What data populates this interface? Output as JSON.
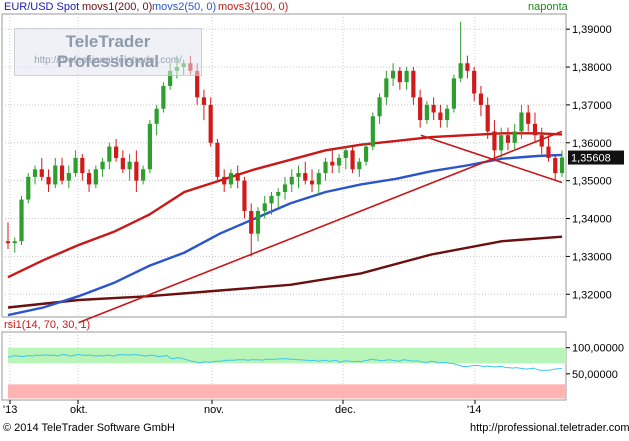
{
  "header": {
    "symbol": "EUR/USD Spot",
    "ma1": "movs1(200, 0)",
    "ma2": "movs2(50, 0)",
    "ma3": "movs3(100, 0)",
    "period": "naponta"
  },
  "watermark": {
    "title": "TeleTrader Professional",
    "url": "http://professional.teletrader.com/"
  },
  "footer": {
    "copyright": "© 2014 TeleTrader Software GmbH",
    "url": "http://professional.teletrader.com"
  },
  "colors": {
    "up": "#2e9e2e",
    "down": "#d11a1a",
    "ma200": "#6b0f0f",
    "ma50": "#2a55cc",
    "ma100": "#c81818",
    "rsi": "#3cc6f0",
    "rsi_upper_band": "#b9f5b9",
    "rsi_lower_band": "#ffb3b3"
  },
  "chart_data": [
    {
      "type": "candlestick",
      "title": "EUR/USD Spot",
      "ylim": [
        1.314,
        1.394
      ],
      "y_ticks": [
        "1,39000",
        "1,38000",
        "1,37000",
        "1,36000",
        "1,35000",
        "1,34000",
        "1,33000",
        "1,32000"
      ],
      "x_ticks": [
        "'13",
        "okt.",
        "nov.",
        "dec.",
        "'14"
      ],
      "last_price_label": "1,35608",
      "grid": true,
      "candles": [
        [
          1.334,
          1.339,
          1.332,
          1.3335
        ],
        [
          1.3335,
          1.335,
          1.331,
          1.334
        ],
        [
          1.334,
          1.346,
          1.333,
          1.345
        ],
        [
          1.345,
          1.352,
          1.344,
          1.351
        ],
        [
          1.351,
          1.354,
          1.349,
          1.353
        ],
        [
          1.353,
          1.356,
          1.35,
          1.351
        ],
        [
          1.351,
          1.353,
          1.347,
          1.349
        ],
        [
          1.349,
          1.356,
          1.348,
          1.354
        ],
        [
          1.354,
          1.356,
          1.349,
          1.35
        ],
        [
          1.35,
          1.354,
          1.348,
          1.352
        ],
        [
          1.352,
          1.358,
          1.351,
          1.356
        ],
        [
          1.356,
          1.357,
          1.35,
          1.352
        ],
        [
          1.352,
          1.353,
          1.347,
          1.349
        ],
        [
          1.349,
          1.354,
          1.348,
          1.353
        ],
        [
          1.353,
          1.356,
          1.351,
          1.355
        ],
        [
          1.355,
          1.36,
          1.353,
          1.359
        ],
        [
          1.359,
          1.361,
          1.355,
          1.356
        ],
        [
          1.356,
          1.358,
          1.352,
          1.353
        ],
        [
          1.353,
          1.357,
          1.35,
          1.355
        ],
        [
          1.355,
          1.358,
          1.347,
          1.35
        ],
        [
          1.35,
          1.354,
          1.349,
          1.353
        ],
        [
          1.353,
          1.366,
          1.352,
          1.365
        ],
        [
          1.365,
          1.37,
          1.362,
          1.369
        ],
        [
          1.369,
          1.376,
          1.368,
          1.375
        ],
        [
          1.375,
          1.381,
          1.374,
          1.379
        ],
        [
          1.379,
          1.383,
          1.377,
          1.38
        ],
        [
          1.38,
          1.382,
          1.378,
          1.381
        ],
        [
          1.381,
          1.383,
          1.378,
          1.379
        ],
        [
          1.379,
          1.381,
          1.37,
          1.372
        ],
        [
          1.372,
          1.374,
          1.366,
          1.37
        ],
        [
          1.37,
          1.372,
          1.359,
          1.36
        ],
        [
          1.36,
          1.361,
          1.35,
          1.351
        ],
        [
          1.351,
          1.353,
          1.347,
          1.349
        ],
        [
          1.349,
          1.353,
          1.348,
          1.352
        ],
        [
          1.352,
          1.354,
          1.348,
          1.35
        ],
        [
          1.35,
          1.351,
          1.34,
          1.342
        ],
        [
          1.342,
          1.344,
          1.33,
          1.336
        ],
        [
          1.336,
          1.343,
          1.334,
          1.342
        ],
        [
          1.342,
          1.346,
          1.34,
          1.344
        ],
        [
          1.344,
          1.347,
          1.341,
          1.346
        ],
        [
          1.346,
          1.348,
          1.343,
          1.347
        ],
        [
          1.347,
          1.351,
          1.345,
          1.349
        ],
        [
          1.349,
          1.353,
          1.347,
          1.351
        ],
        [
          1.351,
          1.354,
          1.348,
          1.352
        ],
        [
          1.352,
          1.355,
          1.349,
          1.35
        ],
        [
          1.35,
          1.353,
          1.347,
          1.349
        ],
        [
          1.349,
          1.353,
          1.346,
          1.352
        ],
        [
          1.352,
          1.356,
          1.35,
          1.355
        ],
        [
          1.355,
          1.358,
          1.352,
          1.354
        ],
        [
          1.354,
          1.357,
          1.352,
          1.356
        ],
        [
          1.356,
          1.359,
          1.353,
          1.358
        ],
        [
          1.358,
          1.359,
          1.352,
          1.353
        ],
        [
          1.353,
          1.356,
          1.351,
          1.355
        ],
        [
          1.355,
          1.36,
          1.354,
          1.359
        ],
        [
          1.359,
          1.368,
          1.358,
          1.367
        ],
        [
          1.367,
          1.373,
          1.365,
          1.372
        ],
        [
          1.372,
          1.379,
          1.37,
          1.377
        ],
        [
          1.377,
          1.381,
          1.375,
          1.379
        ],
        [
          1.379,
          1.38,
          1.374,
          1.376
        ],
        [
          1.376,
          1.38,
          1.374,
          1.379
        ],
        [
          1.379,
          1.38,
          1.37,
          1.372
        ],
        [
          1.372,
          1.374,
          1.364,
          1.366
        ],
        [
          1.366,
          1.371,
          1.365,
          1.37
        ],
        [
          1.37,
          1.372,
          1.366,
          1.368
        ],
        [
          1.368,
          1.37,
          1.364,
          1.366
        ],
        [
          1.366,
          1.37,
          1.364,
          1.369
        ],
        [
          1.369,
          1.378,
          1.368,
          1.377
        ],
        [
          1.377,
          1.392,
          1.376,
          1.381
        ],
        [
          1.381,
          1.383,
          1.377,
          1.379
        ],
        [
          1.379,
          1.38,
          1.371,
          1.373
        ],
        [
          1.373,
          1.375,
          1.367,
          1.37
        ],
        [
          1.37,
          1.372,
          1.361,
          1.363
        ],
        [
          1.363,
          1.366,
          1.356,
          1.358
        ],
        [
          1.358,
          1.364,
          1.356,
          1.362
        ],
        [
          1.362,
          1.364,
          1.358,
          1.36
        ],
        [
          1.36,
          1.365,
          1.358,
          1.363
        ],
        [
          1.363,
          1.37,
          1.361,
          1.368
        ],
        [
          1.368,
          1.37,
          1.363,
          1.365
        ],
        [
          1.365,
          1.368,
          1.36,
          1.362
        ],
        [
          1.362,
          1.364,
          1.357,
          1.359
        ],
        [
          1.359,
          1.362,
          1.355,
          1.356
        ],
        [
          1.356,
          1.357,
          1.35,
          1.352
        ],
        [
          1.352,
          1.358,
          1.351,
          1.3561
        ]
      ],
      "series": [
        {
          "name": "movs1(200, 0)",
          "color": "#6b0f0f",
          "points": [
            [
              0,
              1.3165
            ],
            [
              20,
              1.3185
            ],
            [
              40,
              1.3195
            ],
            [
              60,
              1.321
            ],
            [
              80,
              1.3225
            ],
            [
              100,
              1.3255
            ],
            [
              120,
              1.3305
            ],
            [
              140,
              1.334
            ],
            [
              157,
              1.3352
            ]
          ]
        },
        {
          "name": "movs2(50, 0)",
          "color": "#2a55cc",
          "points": [
            [
              0,
              1.3145
            ],
            [
              10,
              1.3165
            ],
            [
              20,
              1.3195
            ],
            [
              30,
              1.323
            ],
            [
              40,
              1.3275
            ],
            [
              50,
              1.331
            ],
            [
              60,
              1.336
            ],
            [
              70,
              1.34
            ],
            [
              80,
              1.344
            ],
            [
              90,
              1.347
            ],
            [
              100,
              1.349
            ],
            [
              110,
              1.3505
            ],
            [
              120,
              1.3525
            ],
            [
              130,
              1.354
            ],
            [
              140,
              1.3558
            ],
            [
              150,
              1.3565
            ],
            [
              157,
              1.3568
            ]
          ]
        },
        {
          "name": "movs3(100, 0)",
          "color": "#c81818",
          "points": [
            [
              0,
              1.3245
            ],
            [
              10,
              1.329
            ],
            [
              20,
              1.333
            ],
            [
              30,
              1.3365
            ],
            [
              40,
              1.341
            ],
            [
              50,
              1.347
            ],
            [
              60,
              1.35
            ],
            [
              70,
              1.353
            ],
            [
              80,
              1.3555
            ],
            [
              90,
              1.358
            ],
            [
              100,
              1.3595
            ],
            [
              110,
              1.3605
            ],
            [
              120,
              1.3615
            ],
            [
              130,
              1.362
            ],
            [
              140,
              1.3625
            ],
            [
              150,
              1.3625
            ],
            [
              157,
              1.3622
            ]
          ]
        }
      ],
      "trendlines": [
        {
          "from": [
            20,
            1.3125
          ],
          "to": [
            157,
            1.363
          ]
        },
        {
          "from": [
            117,
            1.362
          ],
          "to": [
            157,
            1.3495
          ]
        }
      ]
    },
    {
      "type": "line",
      "title": "rsi1(14, 70, 30, 1)",
      "ylim": [
        0,
        130
      ],
      "y_ticks": [
        "100,00000",
        "50,00000"
      ],
      "overbought": 70,
      "oversold": 30,
      "series": [
        {
          "name": "rsi1(14, 70, 30, 1)",
          "color": "#3cc6f0",
          "values": [
            82,
            83,
            85,
            84,
            83,
            84,
            85,
            84,
            86,
            85,
            86,
            86,
            85,
            86,
            84,
            86,
            87,
            85,
            84,
            86,
            87,
            86,
            85,
            86,
            85,
            84,
            85,
            84,
            86,
            85,
            84,
            86,
            87,
            86,
            86,
            86,
            87,
            86,
            85,
            84,
            85,
            86,
            84,
            83,
            84,
            85,
            80,
            79,
            81,
            80,
            78,
            76,
            74,
            73,
            71,
            72,
            73,
            72,
            73,
            74,
            74,
            75,
            76,
            76,
            76,
            77,
            77,
            77,
            76,
            77,
            77,
            77,
            76,
            78,
            78,
            78,
            78,
            79,
            79,
            79,
            78,
            78,
            77,
            77,
            76,
            76,
            75,
            76,
            74,
            75,
            76,
            74,
            75,
            76,
            72,
            74,
            75,
            74,
            73,
            74,
            73,
            75,
            76,
            78,
            77,
            76,
            75,
            76,
            77,
            76,
            75,
            74,
            77,
            76,
            75,
            74,
            75,
            73,
            72,
            72,
            74,
            73,
            71,
            71,
            72,
            70,
            70,
            68,
            66,
            64,
            64,
            65,
            66,
            66,
            65,
            64,
            65,
            64,
            63,
            64,
            64,
            62,
            62,
            61,
            62,
            61,
            60,
            59,
            60,
            61,
            58,
            57,
            57,
            57,
            58,
            59,
            60,
            60
          ]
        }
      ]
    }
  ]
}
